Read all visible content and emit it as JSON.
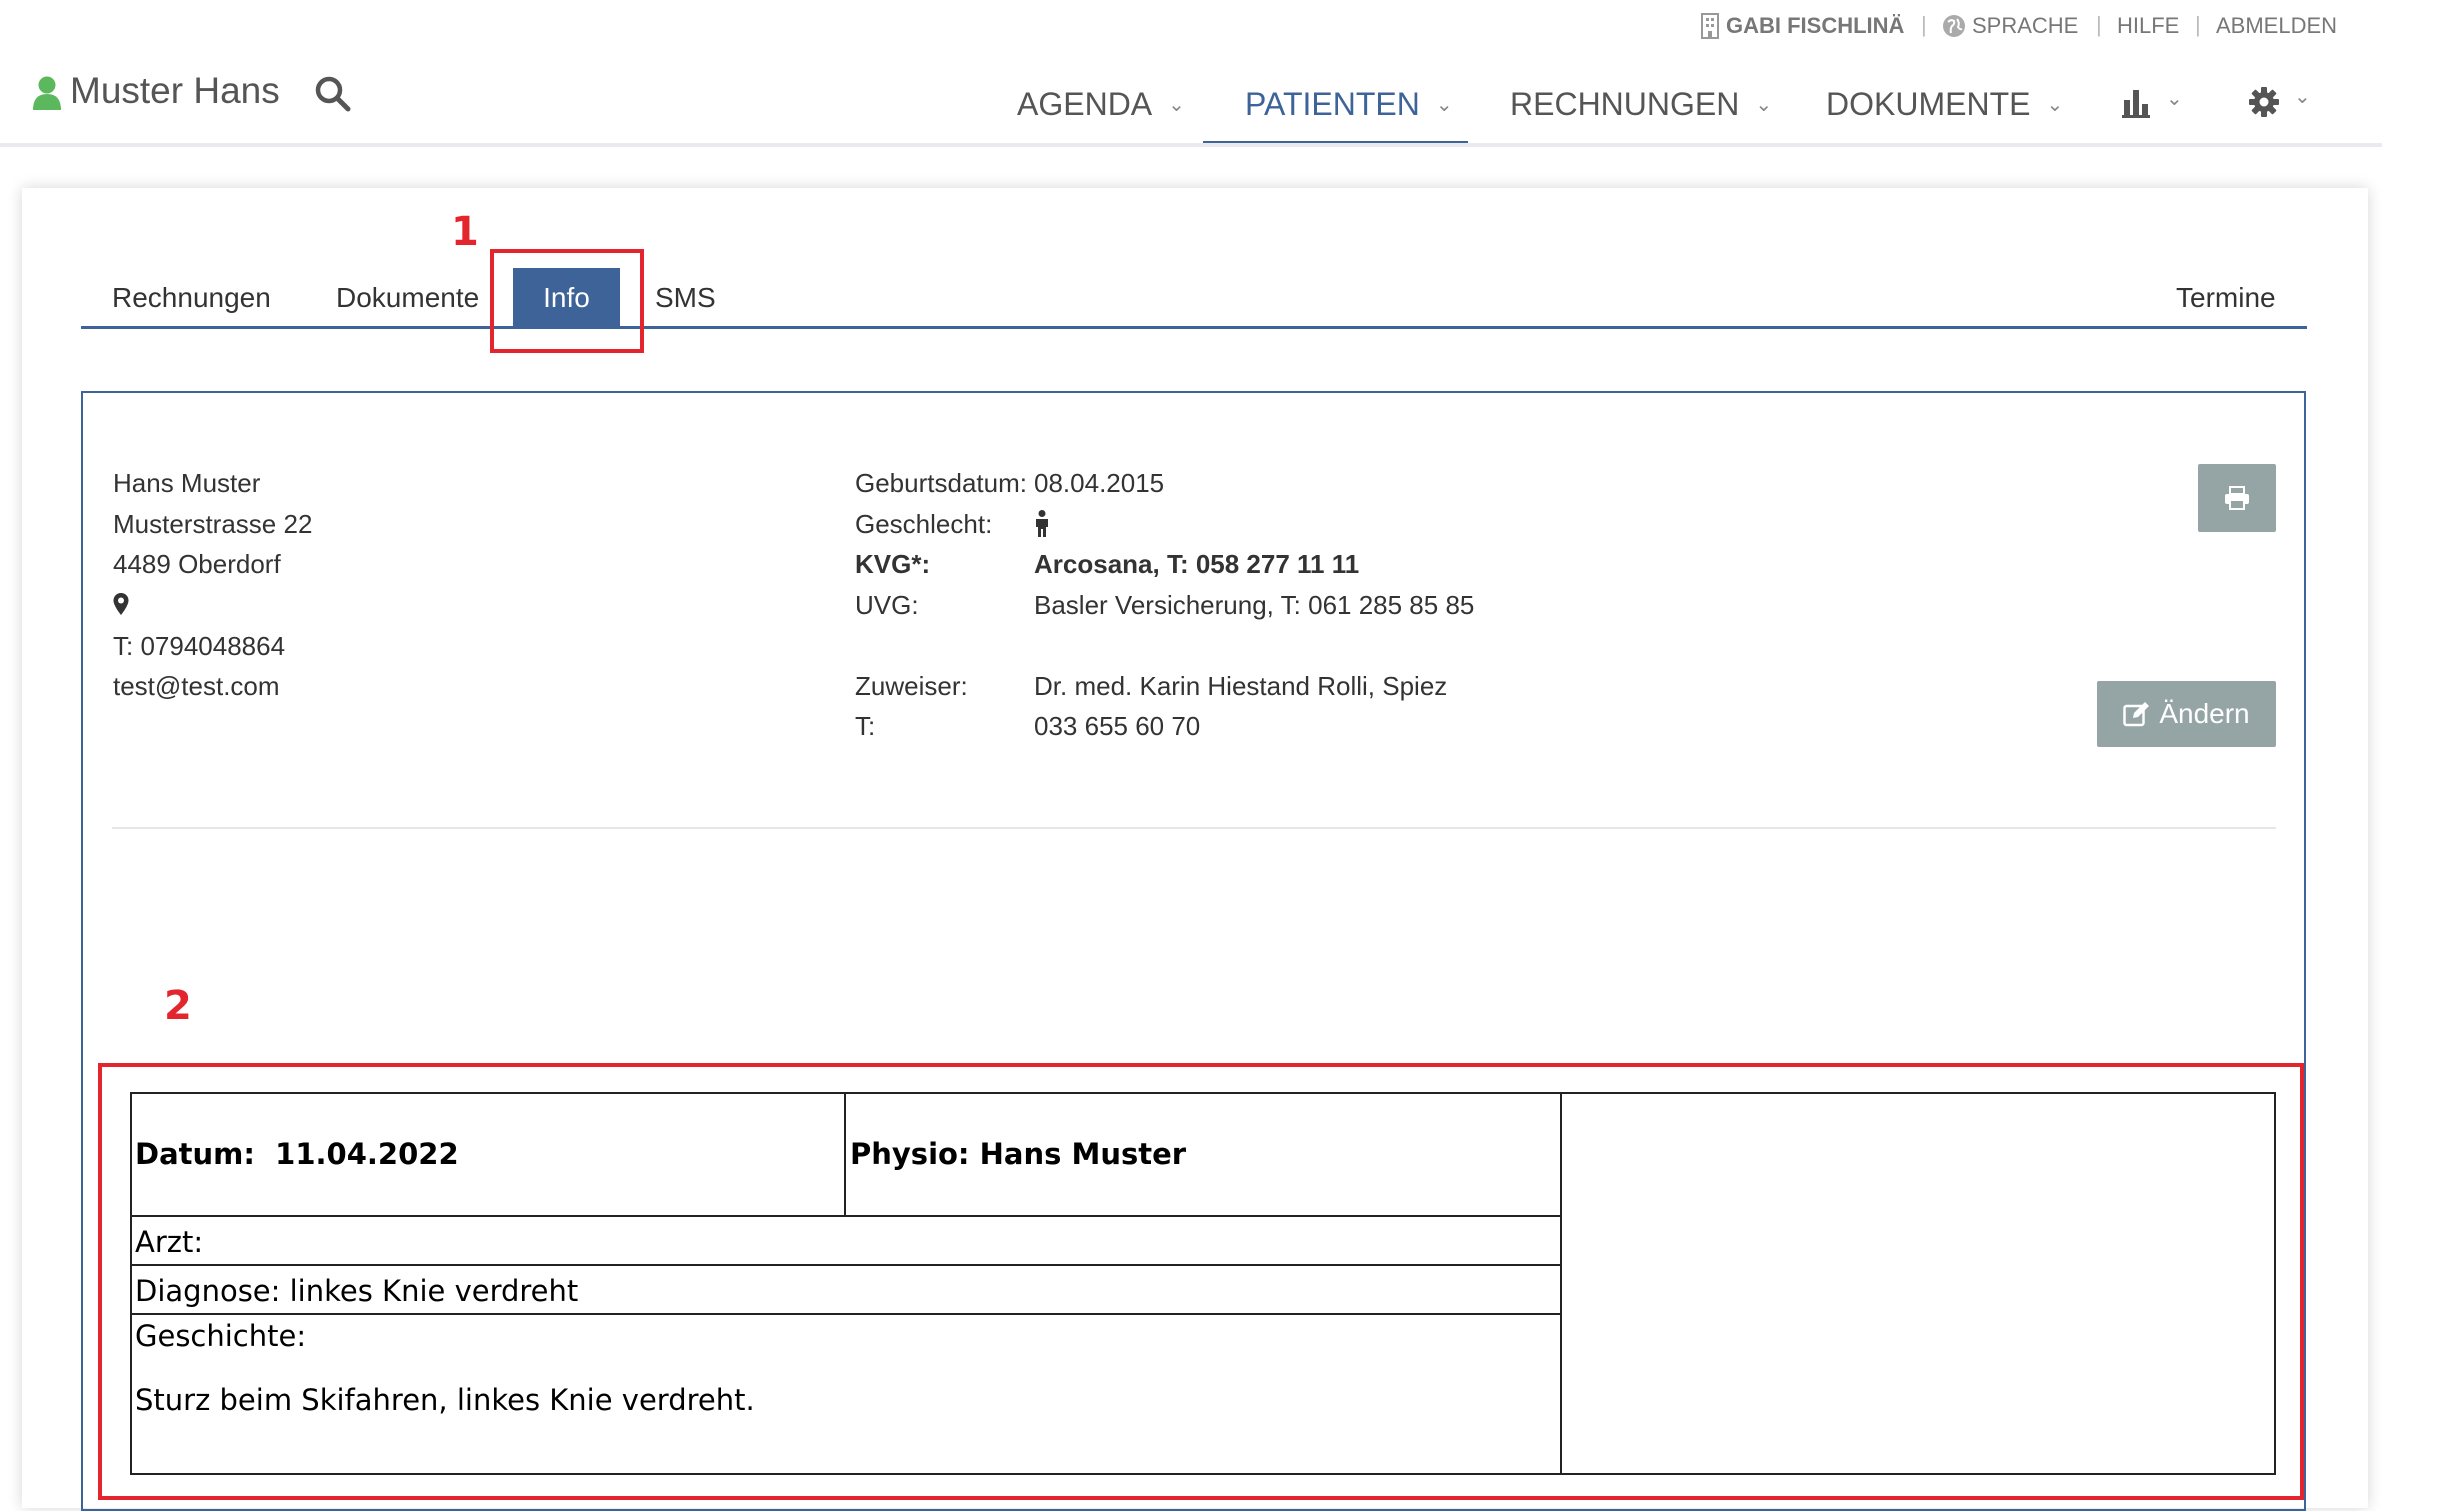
{
  "topbar": {
    "user_name": "GABI FISCHLINÄ",
    "language": "SPRACHE",
    "help": "HILFE",
    "logout": "ABMELDEN"
  },
  "header": {
    "patient_name": "Muster Hans",
    "nav": {
      "agenda": "AGENDA",
      "patients": "PATIENTEN",
      "invoices": "RECHNUNGEN",
      "documents": "DOKUMENTE"
    }
  },
  "tabs": {
    "invoices": "Rechnungen",
    "documents": "Dokumente",
    "info": "Info",
    "sms": "SMS",
    "appointments": "Termine"
  },
  "patient": {
    "name": "Hans Muster",
    "street": "Musterstrasse 22",
    "city": "4489 Oberdorf",
    "phone": "T: 0794048864",
    "email": "test@test.com"
  },
  "details": {
    "birthdate_label": "Geburtsdatum:",
    "birthdate": "08.04.2015",
    "gender_label": "Geschlecht:",
    "kvg_label": "KVG*:",
    "kvg_value": "Arcosana, T: 058 277 11 11",
    "uvg_label": "UVG:",
    "uvg_value": "Basler Versicherung, T: 061 285 85 85",
    "referrer_label": "Zuweiser:",
    "referrer_value": "Dr. med. Karin Hiestand Rolli, Spiez",
    "referrer_phone_label": "T:",
    "referrer_phone": "033 655 60 70"
  },
  "actions": {
    "edit_label": "Ändern"
  },
  "annotations": {
    "marker1": "1",
    "marker2": "2"
  },
  "report": {
    "date_label": "Datum:",
    "date": "11.04.2022",
    "physio": "Physio: Hans Muster",
    "doctor": "Arzt:",
    "diagnosis": "Diagnose: linkes Knie verdreht",
    "history_label": "Geschichte:",
    "history": "Sturz beim Skifahren, linkes Knie verdreht."
  },
  "colors": {
    "accent": "#3d6398",
    "button_gray": "#95a5a6",
    "user_icon_green": "#5cb85c",
    "annotation_red": "#e3262e"
  }
}
